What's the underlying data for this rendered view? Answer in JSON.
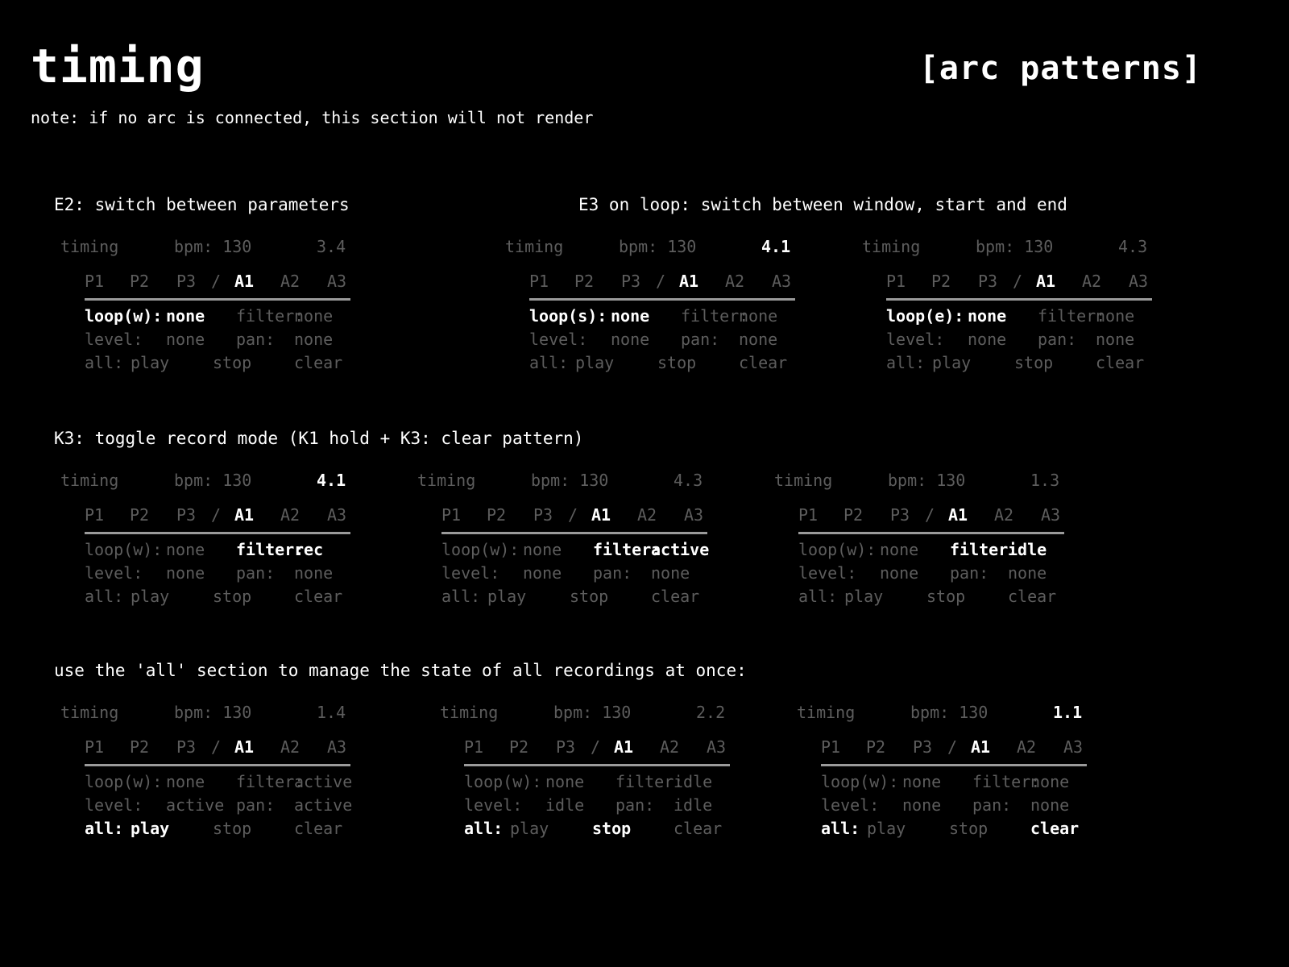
{
  "header": {
    "title": "timing",
    "section_tag": "[arc patterns]",
    "note": "note: if no arc is connected, this section will not render"
  },
  "captions": {
    "e2": "E2: switch between parameters",
    "e3": "E3 on loop: switch between window, start and end",
    "k3": "K3: toggle record mode (K1 hold + K3: clear pattern)",
    "all": "use the 'all' section to manage the state of all recordings at once:"
  },
  "labels": {
    "timing": "timing",
    "bpm": "bpm: 130",
    "tabs": [
      "P1",
      "P2",
      "P3",
      "/",
      "A1",
      "A2",
      "A3"
    ],
    "filter": "filter:",
    "level": "level:",
    "pan": "pan:",
    "all": "all:",
    "play": "play",
    "stop": "stop",
    "clear": "clear"
  },
  "colors": {
    "background": "#000000",
    "active": "#ffffff",
    "dim": "#5d5d5d",
    "rule": "#9a9a9a"
  },
  "panels": [
    {
      "id": "e2",
      "position": "3.4",
      "pos_hi": false,
      "loop_label": "loop(w):",
      "loop_val": "none",
      "filter_val": "none",
      "level_val": "none",
      "pan_val": "none",
      "hi": "loop",
      "all_hi": ""
    },
    {
      "id": "e3-s",
      "position": "4.1",
      "pos_hi": true,
      "loop_label": "loop(s):",
      "loop_val": "none",
      "filter_val": "none",
      "level_val": "none",
      "pan_val": "none",
      "hi": "loop",
      "all_hi": ""
    },
    {
      "id": "e3-e",
      "position": "4.3",
      "pos_hi": false,
      "loop_label": "loop(e):",
      "loop_val": "none",
      "filter_val": "none",
      "level_val": "none",
      "pan_val": "none",
      "hi": "loop",
      "all_hi": ""
    },
    {
      "id": "k3-rec",
      "position": "4.1",
      "pos_hi": true,
      "loop_label": "loop(w):",
      "loop_val": "none",
      "filter_val": "rec",
      "level_val": "none",
      "pan_val": "none",
      "hi": "filter",
      "all_hi": ""
    },
    {
      "id": "k3-active",
      "position": "4.3",
      "pos_hi": false,
      "loop_label": "loop(w):",
      "loop_val": "none",
      "filter_val": "active",
      "level_val": "none",
      "pan_val": "none",
      "hi": "filter",
      "all_hi": ""
    },
    {
      "id": "k3-idle",
      "position": "1.3",
      "pos_hi": false,
      "loop_label": "loop(w):",
      "loop_val": "none",
      "filter_val": "idle",
      "level_val": "none",
      "pan_val": "none",
      "hi": "filter",
      "all_hi": ""
    },
    {
      "id": "all-play",
      "position": "1.4",
      "pos_hi": false,
      "loop_label": "loop(w):",
      "loop_val": "none",
      "filter_val": "active",
      "level_val": "active",
      "pan_val": "active",
      "hi": "all",
      "all_hi": "play"
    },
    {
      "id": "all-stop",
      "position": "2.2",
      "pos_hi": false,
      "loop_label": "loop(w):",
      "loop_val": "none",
      "filter_val": "idle",
      "level_val": "idle",
      "pan_val": "idle",
      "hi": "all",
      "all_hi": "stop"
    },
    {
      "id": "all-clear",
      "position": "1.1",
      "pos_hi": true,
      "loop_label": "loop(w):",
      "loop_val": "none",
      "filter_val": "none",
      "level_val": "none",
      "pan_val": "none",
      "hi": "all",
      "all_hi": "clear"
    }
  ]
}
